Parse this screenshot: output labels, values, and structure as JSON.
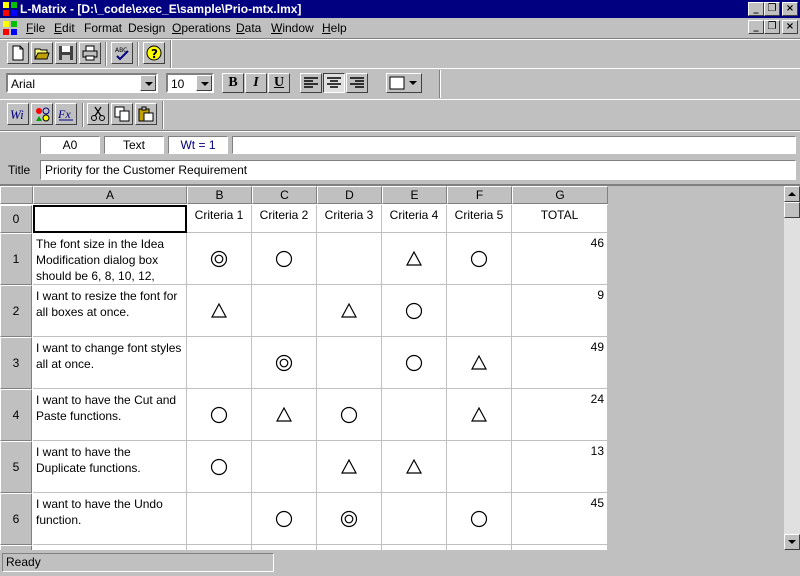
{
  "window": {
    "title": "L-Matrix - [D:\\_code\\exec_E\\sample\\Prio-mtx.lmx]",
    "minimize_glyph": "_",
    "restore_glyph": "❐",
    "close_glyph": "×"
  },
  "menu": [
    {
      "accel": "F",
      "rest": "ile"
    },
    {
      "accel": "E",
      "rest": "dit"
    },
    {
      "accel": "F",
      "rest": "ormat",
      "plain": true
    },
    {
      "accel": "D",
      "rest": "esign",
      "plain": true
    },
    {
      "accel": "O",
      "rest": "perations"
    },
    {
      "accel": "D",
      "rest": "ata"
    },
    {
      "accel": "W",
      "rest": "indow"
    },
    {
      "accel": "H",
      "rest": "elp"
    }
  ],
  "toolbar": {
    "icons": [
      "new-file-icon",
      "open-folder-icon",
      "save-disk-icon",
      "print-icon",
      "spellcheck-icon",
      "help-icon"
    ]
  },
  "format_bar": {
    "font": "Arial",
    "size": "10",
    "bold": "B",
    "italic": "I",
    "underline": "U"
  },
  "editor": {
    "cell_ref": "A0",
    "cell_type": "Text",
    "weight": "Wt = 1",
    "formula": "",
    "title_label": "Title",
    "title_value": "Priority for the Customer Requirement"
  },
  "grid": {
    "columns": [
      "A",
      "B",
      "C",
      "D",
      "E",
      "F",
      "G"
    ],
    "header_row": {
      "row_num": "0",
      "cells": [
        "",
        "Criteria 1",
        "Criteria 2",
        "Criteria 3",
        "Criteria 4",
        "Criteria 5",
        "TOTAL"
      ]
    },
    "rows": [
      {
        "row_num": "1",
        "text": "The font size in the Idea Modification dialog box should be 6, 8, 10, 12,",
        "marks": [
          "double-circle",
          "circle",
          "",
          "triangle",
          "circle"
        ],
        "total": "46"
      },
      {
        "row_num": "2",
        "text": "I want to resize the  font for all boxes at once.",
        "marks": [
          "triangle",
          "",
          "triangle",
          "circle",
          ""
        ],
        "total": "9"
      },
      {
        "row_num": "3",
        "text": "I want to change font styles all at once.",
        "marks": [
          "",
          "double-circle",
          "",
          "circle",
          "triangle"
        ],
        "total": "49"
      },
      {
        "row_num": "4",
        "text": "I want to have the Cut and Paste functions.",
        "marks": [
          "circle",
          "triangle",
          "circle",
          "",
          "triangle"
        ],
        "total": "24"
      },
      {
        "row_num": "5",
        "text": "I want to have the Duplicate functions.",
        "marks": [
          "circle",
          "",
          "triangle",
          "triangle",
          ""
        ],
        "total": "13"
      },
      {
        "row_num": "6",
        "text": "I want to have the Undo function.",
        "marks": [
          "",
          "circle",
          "double-circle",
          "",
          "circle"
        ],
        "total": "45"
      }
    ]
  },
  "status": {
    "text": "Ready"
  }
}
